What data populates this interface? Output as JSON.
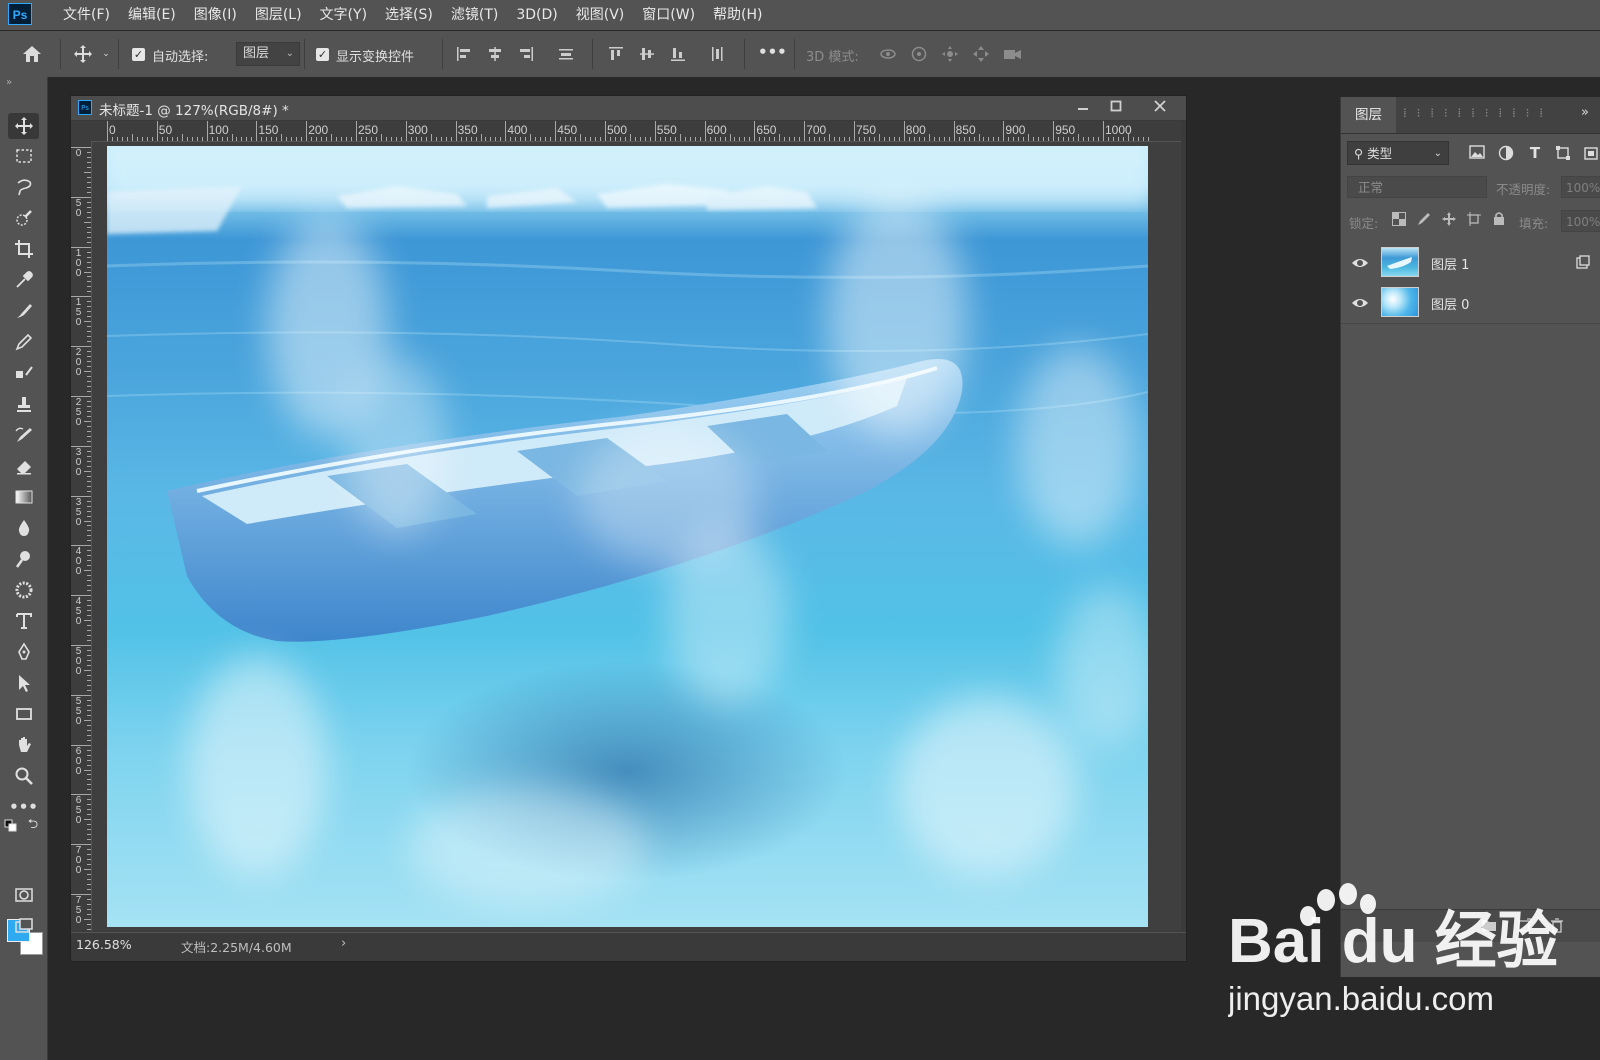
{
  "app": {
    "logo": "Ps"
  },
  "menu": [
    "文件(F)",
    "编辑(E)",
    "图像(I)",
    "图层(L)",
    "文字(Y)",
    "选择(S)",
    "滤镜(T)",
    "3D(D)",
    "视图(V)",
    "窗口(W)",
    "帮助(H)"
  ],
  "options": {
    "auto_select_label": "自动选择:",
    "auto_select_checked": true,
    "auto_select_target": "图层",
    "show_transform_label": "显示变换控件",
    "show_transform_checked": true,
    "more": "•••",
    "mode_3d_label": "3D 模式:"
  },
  "document": {
    "title": "未标题-1 @ 127%(RGB/8#) *",
    "zoom": "126.58%",
    "info": "文档:2.25M/4.60M",
    "info_arrow": "›",
    "ruler_h": [
      "0",
      "50",
      "100",
      "150",
      "200",
      "250",
      "300",
      "350",
      "400",
      "450",
      "500",
      "550",
      "600",
      "650",
      "700",
      "750",
      "800",
      "850",
      "900",
      "950",
      "1000"
    ],
    "ruler_v": [
      "0",
      "50",
      "100",
      "150",
      "200",
      "250",
      "300",
      "350",
      "400",
      "450",
      "500",
      "550",
      "600",
      "650",
      "700",
      "750"
    ]
  },
  "colors": {
    "foreground": "#2faaf0",
    "background": "#ffffff",
    "ui_dark": "#535353",
    "canvas_bg": "#282828"
  },
  "layers_panel": {
    "tab": "图层",
    "filter_label": "类型",
    "blend_mode": "正常",
    "opacity_label": "不透明度:",
    "opacity_value": "100%",
    "lock_label": "锁定:",
    "fill_label": "填充:",
    "fill_value": "100%",
    "layers": [
      {
        "name": "图层 1",
        "visible": true,
        "thumb": "boat"
      },
      {
        "name": "图层 0",
        "visible": true,
        "thumb": "water"
      }
    ]
  },
  "watermark": {
    "brand": "Bai du 经验",
    "url": "jingyan.baidu.com"
  }
}
